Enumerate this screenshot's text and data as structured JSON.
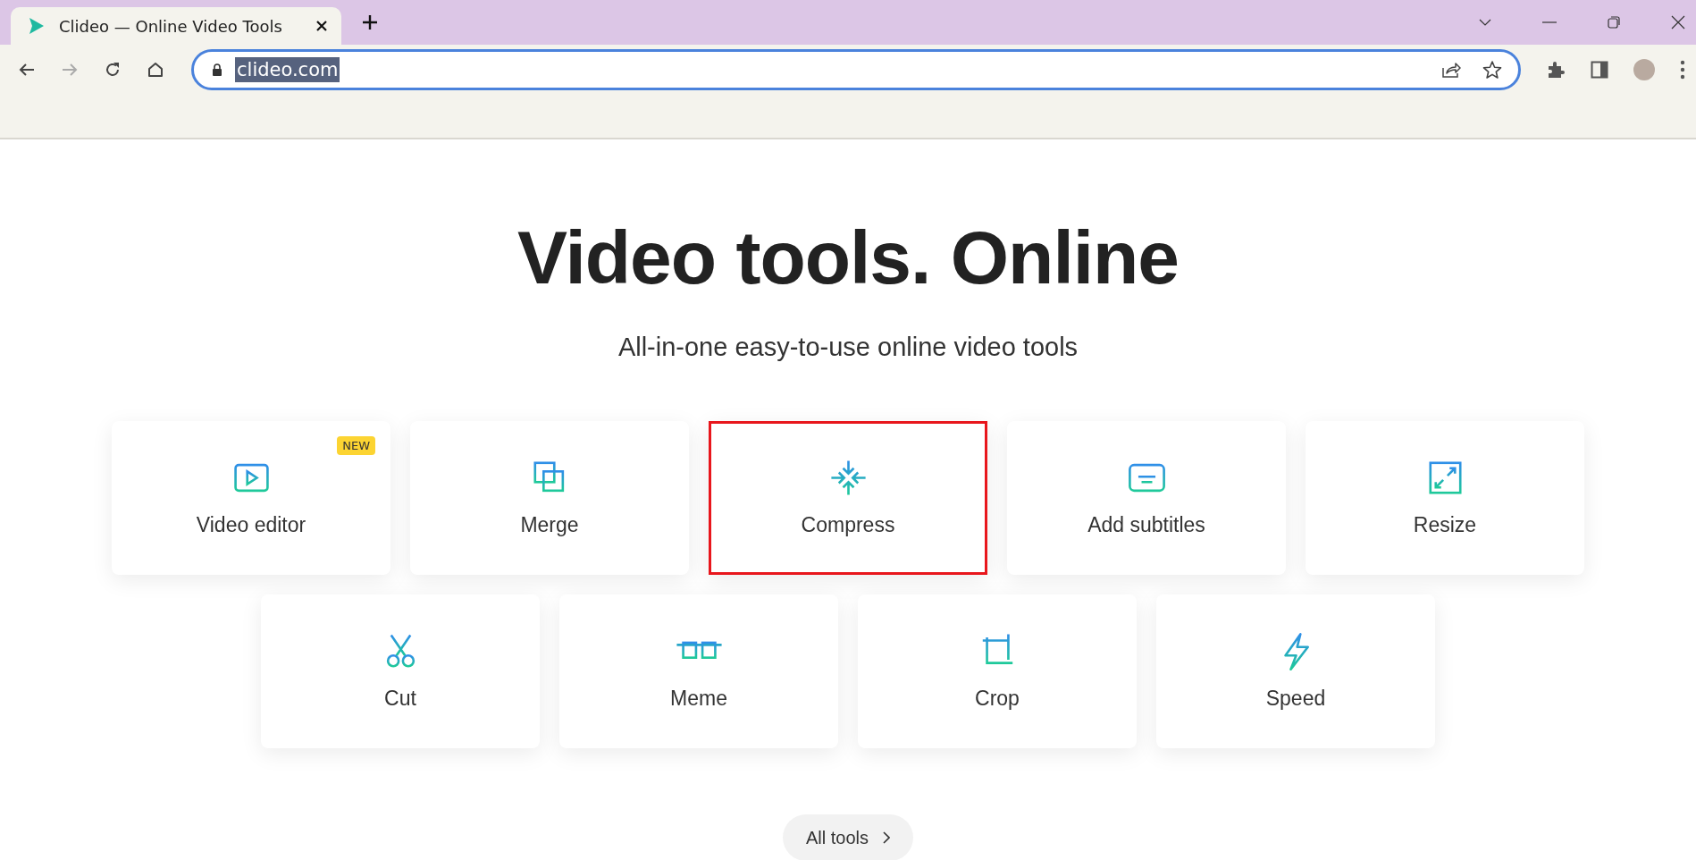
{
  "browser": {
    "tab": {
      "title": "Clideo — Online Video Tools",
      "selected": true
    },
    "address": "clideo.com"
  },
  "page": {
    "heading": "Video tools. Online",
    "subheading": "All-in-one easy-to-use online video tools",
    "tools": [
      {
        "label": "Video editor",
        "badge": "NEW",
        "highlighted": false
      },
      {
        "label": "Merge",
        "highlighted": false
      },
      {
        "label": "Compress",
        "highlighted": true
      },
      {
        "label": "Add subtitles",
        "highlighted": false
      },
      {
        "label": "Resize",
        "highlighted": false
      },
      {
        "label": "Cut",
        "highlighted": false
      },
      {
        "label": "Meme",
        "highlighted": false
      },
      {
        "label": "Crop",
        "highlighted": false
      },
      {
        "label": "Speed",
        "highlighted": false
      }
    ],
    "all_tools_button": "All tools"
  }
}
